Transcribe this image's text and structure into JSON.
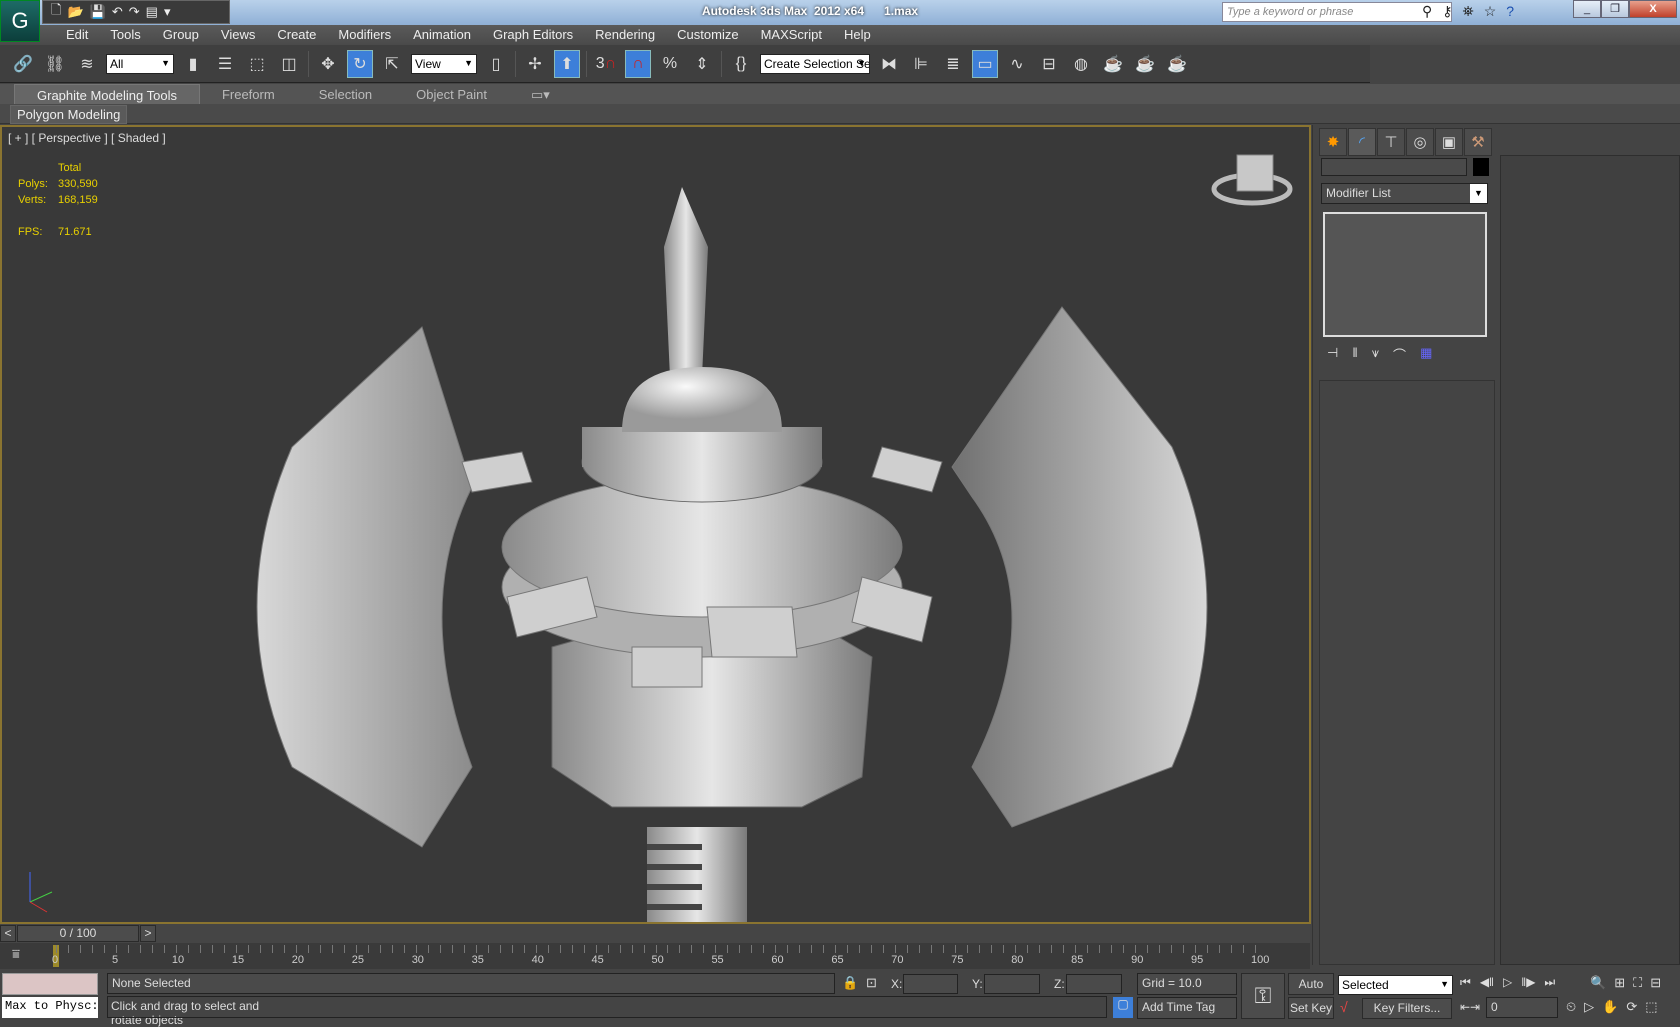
{
  "app": {
    "title": "Autodesk 3ds Max  2012 x64      1.max",
    "logo": "3ds Max logo",
    "search_placeholder": "Type a keyword or phrase"
  },
  "menu": [
    "Edit",
    "Tools",
    "Group",
    "Views",
    "Create",
    "Modifiers",
    "Animation",
    "Graph Editors",
    "Rendering",
    "Customize",
    "MAXScript",
    "Help"
  ],
  "toolbar": {
    "selection_filter": "All",
    "ref_coord": "View",
    "named_selection": "Create Selection Se",
    "snap_number": "3"
  },
  "ribbon": {
    "tabs": [
      "Graphite Modeling Tools",
      "Freeform",
      "Selection",
      "Object Paint"
    ],
    "active_tab": "Graphite Modeling Tools",
    "panel": "Polygon Modeling"
  },
  "viewport": {
    "label": "[ + ] [ Perspective ] [ Shaded ]",
    "stats": {
      "header": "Total",
      "polys_label": "Polys:",
      "polys": "330,590",
      "verts_label": "Verts:",
      "verts": "168,159",
      "fps_label": "FPS:",
      "fps": "71.671"
    },
    "stats_color": "#e8d000",
    "border_color": "#8a7430"
  },
  "command_panel": {
    "tabs": [
      "create-icon",
      "modify-icon",
      "hierarchy-icon",
      "motion-icon",
      "display-icon",
      "utilities-icon"
    ],
    "active_tab": "modify-icon",
    "modifier_list": "Modifier List"
  },
  "time": {
    "slider": "0 / 100",
    "prev": "<",
    "next": ">",
    "ticks": [
      "0",
      "5",
      "10",
      "15",
      "20",
      "25",
      "30",
      "35",
      "40",
      "45",
      "50",
      "55",
      "60",
      "65",
      "70",
      "75",
      "80",
      "85",
      "90",
      "95",
      "100"
    ],
    "current_frame": "0"
  },
  "status": {
    "maxscript": "Max to Physc:",
    "selection": "None Selected",
    "prompt": "Click and drag to select and rotate objects",
    "x_label": "X:",
    "y_label": "Y:",
    "z_label": "Z:",
    "grid": "Grid = 10.0",
    "add_time_tag": "Add Time Tag",
    "auto_key": "Auto Key",
    "set_key": "Set Key",
    "key_mode": "Selected",
    "key_filters": "Key Filters...",
    "frame": "0"
  }
}
